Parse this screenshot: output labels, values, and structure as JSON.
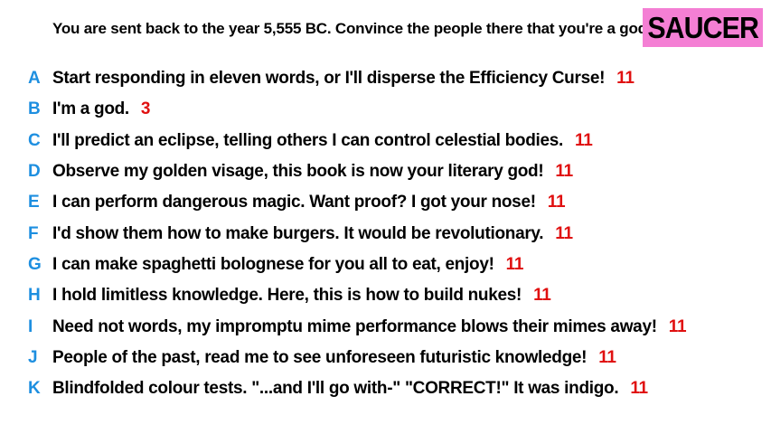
{
  "prompt": "You are sent back to the year 5,555 BC. Convince the people there that you're a god.",
  "logo": "SAUCER",
  "colors": {
    "letter": "#1e8fe0",
    "count": "#e01010",
    "logo_bg": "#f47fd4"
  },
  "answers": [
    {
      "letter": "A",
      "text": "Start responding in eleven words, or I'll disperse the Efficiency Curse!",
      "count": "11"
    },
    {
      "letter": "B",
      "text": "I'm a god.",
      "count": "3"
    },
    {
      "letter": "C",
      "text": "I'll predict an eclipse, telling others I can control celestial bodies.",
      "count": "11"
    },
    {
      "letter": "D",
      "text": "Observe my golden visage, this book is now your literary god!",
      "count": "11"
    },
    {
      "letter": "E",
      "text": "I can perform dangerous magic. Want proof? I got your nose!",
      "count": "11"
    },
    {
      "letter": "F",
      "text": "I'd show them how to make burgers. It would be revolutionary.",
      "count": "11"
    },
    {
      "letter": "G",
      "text": "I can make spaghetti bolognese for you all to eat, enjoy!",
      "count": "11"
    },
    {
      "letter": "H",
      "text": "I hold limitless knowledge. Here, this is how to build nukes!",
      "count": "11"
    },
    {
      "letter": "I",
      "text": "Need not words, my impromptu mime performance blows their mimes away!",
      "count": "11"
    },
    {
      "letter": "J",
      "text": "People of the past, read me to see unforeseen futuristic knowledge!",
      "count": "11"
    },
    {
      "letter": "K",
      "text": "Blindfolded colour tests. \"...and I'll go with-\" \"CORRECT!\" It was indigo.",
      "count": "11"
    }
  ]
}
